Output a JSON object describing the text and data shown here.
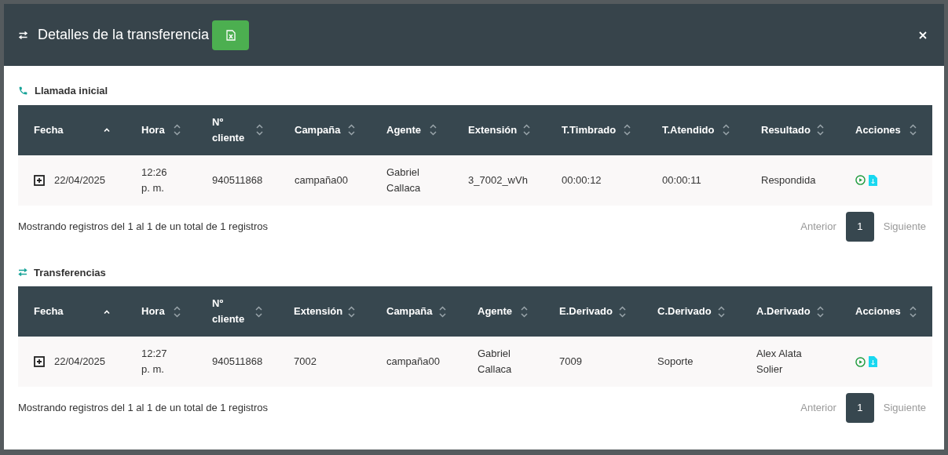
{
  "modal": {
    "title": "Detalles de la transferencia"
  },
  "sections": [
    {
      "title": "Llamada inicial",
      "columns": [
        {
          "label": "Fecha",
          "sorted": true
        },
        {
          "label": "Hora",
          "sorted": false
        },
        {
          "label": "Nº cliente",
          "sorted": false
        },
        {
          "label": "Campaña",
          "sorted": false
        },
        {
          "label": "Agente",
          "sorted": false
        },
        {
          "label": "Extensión",
          "sorted": false
        },
        {
          "label": "T.Timbrado",
          "sorted": false
        },
        {
          "label": "T.Atendido",
          "sorted": false
        },
        {
          "label": "Resultado",
          "sorted": false
        },
        {
          "label": "Acciones",
          "sorted": false
        }
      ],
      "rows": [
        [
          "22/04/2025",
          "12:26 p. m.",
          "940511868",
          "campaña00",
          "Gabriel Callaca",
          "3_7002_wVh",
          "00:00:12",
          "00:00:11",
          "Respondida"
        ]
      ],
      "info": "Mostrando registros del 1 al 1 de un total de 1 registros",
      "pagination": {
        "previous": "Anterior",
        "pages": [
          {
            "label": "1",
            "selected": true
          }
        ],
        "next": "Siguiente"
      }
    },
    {
      "title": "Transferencias",
      "columns": [
        {
          "label": "Fecha",
          "sorted": true
        },
        {
          "label": "Hora",
          "sorted": false
        },
        {
          "label": "Nº cliente",
          "sorted": false
        },
        {
          "label": "Extensión",
          "sorted": false
        },
        {
          "label": "Campaña",
          "sorted": false
        },
        {
          "label": "Agente",
          "sorted": false
        },
        {
          "label": "E.Derivado",
          "sorted": false
        },
        {
          "label": "C.Derivado",
          "sorted": false
        },
        {
          "label": "A.Derivado",
          "sorted": false
        },
        {
          "label": "Acciones",
          "sorted": false
        }
      ],
      "rows": [
        [
          "22/04/2025",
          "12:27 p. m.",
          "940511868",
          "7002",
          "campaña00",
          "Gabriel Callaca",
          "7009",
          "Soporte",
          "Alex Alata Solier"
        ]
      ],
      "info": "Mostrando registros del 1 al 1 de un total de 1 registros",
      "pagination": {
        "previous": "Anterior",
        "pages": [
          {
            "label": "1",
            "selected": true
          }
        ],
        "next": "Siguiente"
      }
    }
  ]
}
